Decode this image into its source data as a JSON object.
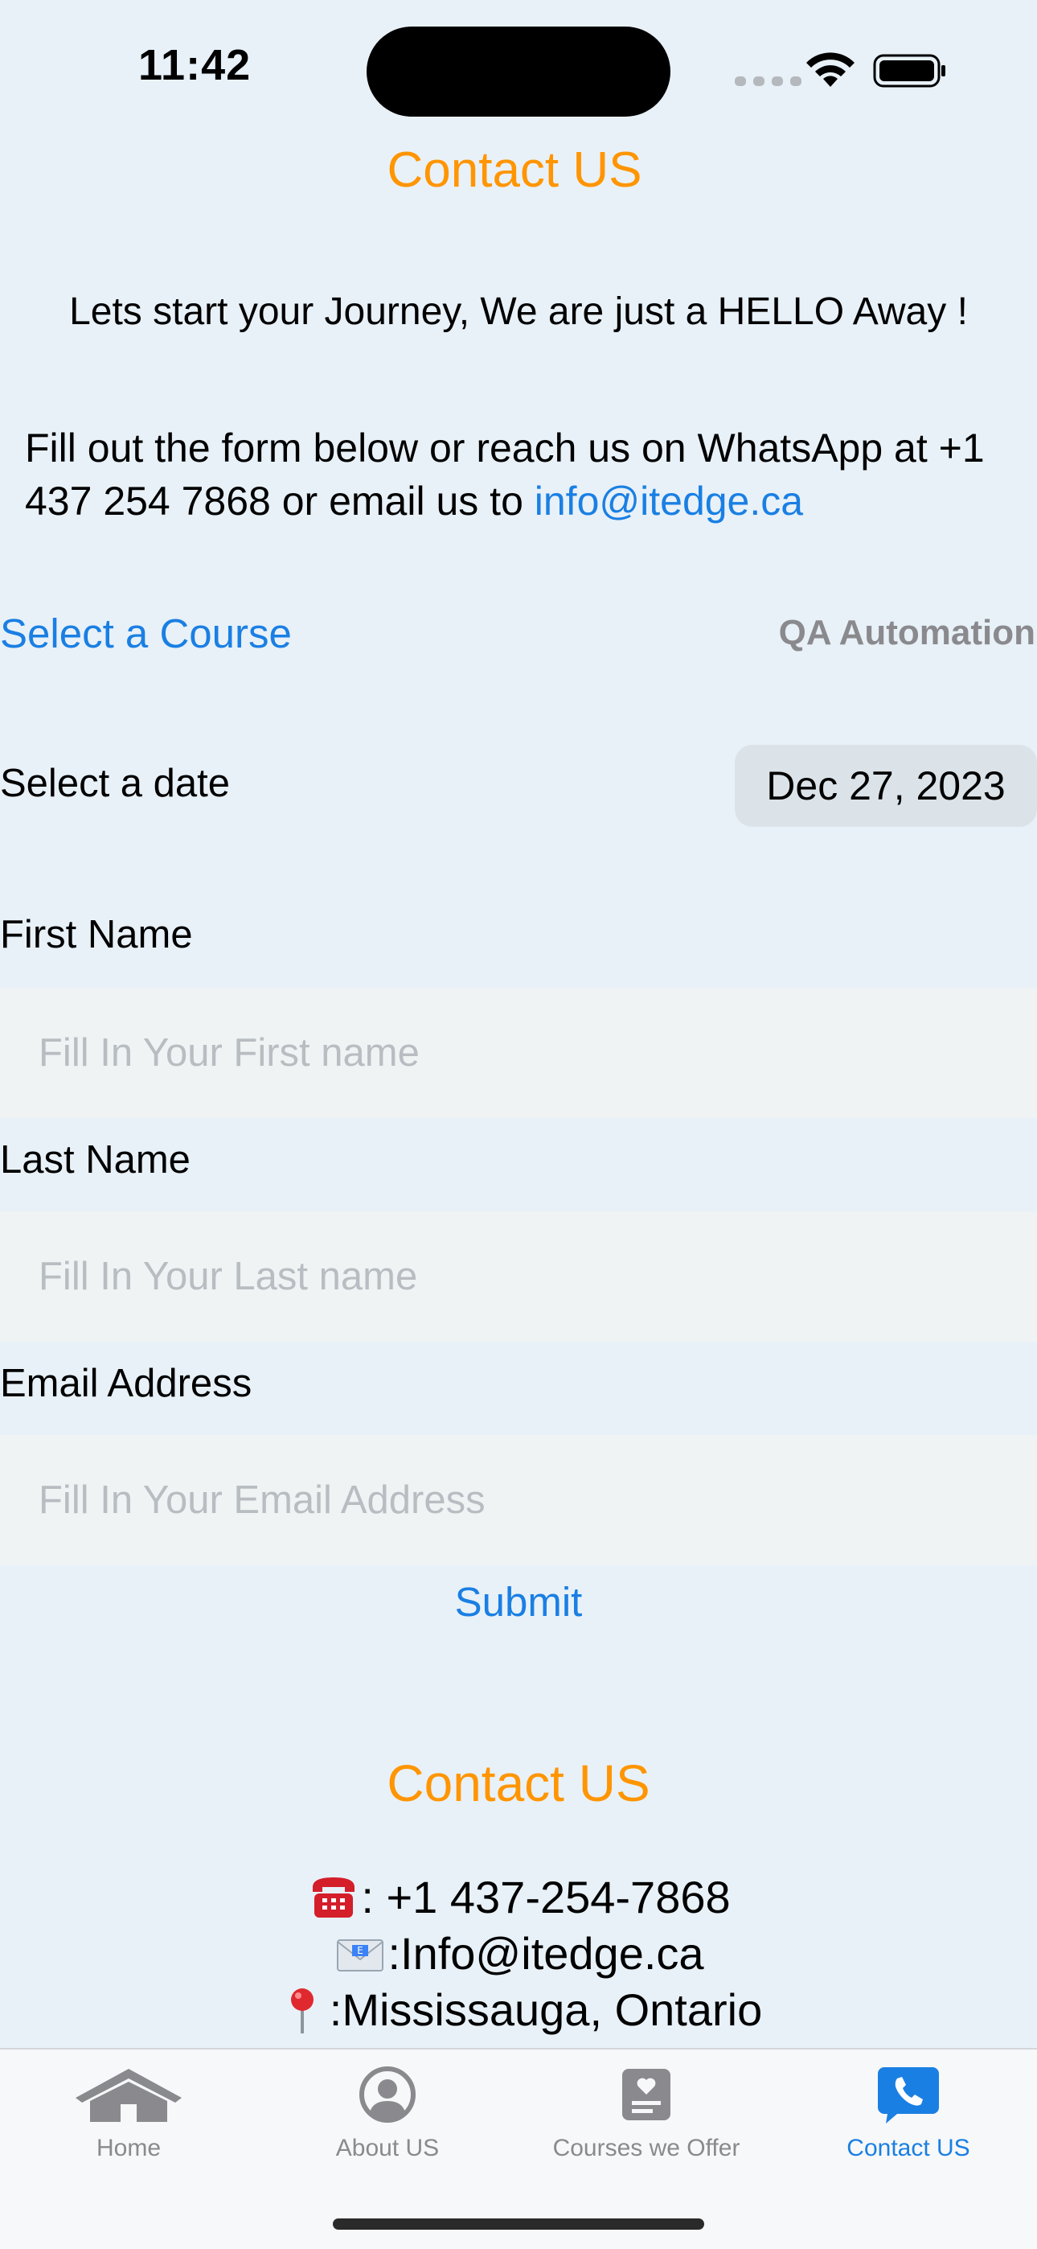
{
  "status_bar": {
    "time": "11:42"
  },
  "header": {
    "title": "Contact US",
    "tagline": "Lets start your Journey, We are just a HELLO Away !",
    "info_text": "Fill out the form below or reach us on WhatsApp at +1 437 254 7868 or email us to ",
    "info_email": "info@itedge.ca"
  },
  "course_picker": {
    "label": "Select a Course",
    "value": "QA Automation"
  },
  "date_picker": {
    "label": "Select a date",
    "value": "Dec 27, 2023"
  },
  "form": {
    "first_name": {
      "label": "First Name",
      "value": "",
      "placeholder": "Fill In Your First name"
    },
    "last_name": {
      "label": "Last Name",
      "value": "",
      "placeholder": "Fill In Your Last name"
    },
    "email": {
      "label": "Email Address",
      "value": "",
      "placeholder": "Fill In Your Email Address"
    },
    "submit_label": "Submit"
  },
  "contact": {
    "heading": "Contact US",
    "phone": ": +1 437-254-7868",
    "email": ":Info@itedge.ca",
    "location": ":Mississauga, Ontario",
    "phone_icon": "telephone-icon",
    "email_icon": "envelope-icon",
    "location_icon": "pin-icon"
  },
  "tab_bar": {
    "tabs": [
      {
        "label": "Home",
        "icon": "house-icon",
        "active": false
      },
      {
        "label": "About US",
        "icon": "person-circle-icon",
        "active": false
      },
      {
        "label": "Courses we Offer",
        "icon": "list-card-icon",
        "active": false
      },
      {
        "label": "Contact US",
        "icon": "phone-bubble-icon",
        "active": true
      }
    ]
  },
  "colors": {
    "background": "#E8F1F8",
    "accent_orange": "#FF9500",
    "link_blue": "#1A7FE3",
    "inactive_gray": "#8A8A8E"
  }
}
